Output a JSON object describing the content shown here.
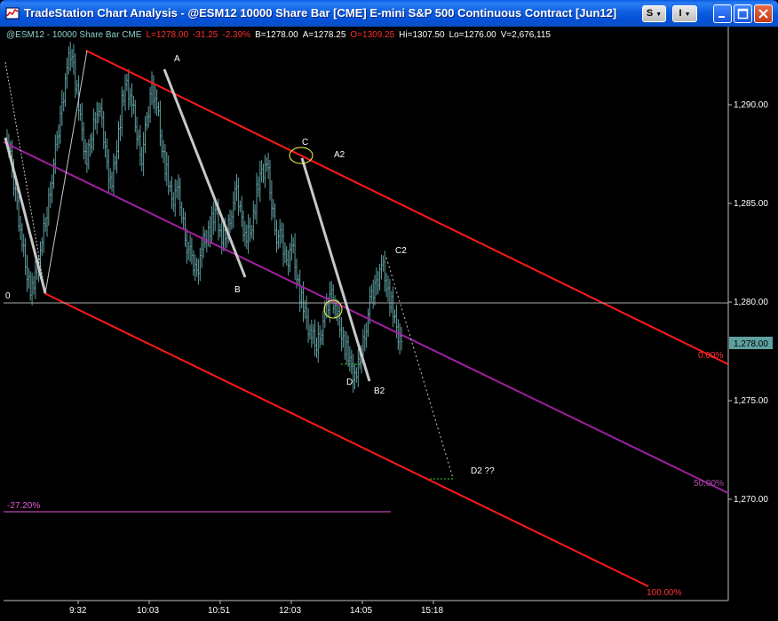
{
  "window": {
    "title": "TradeStation Chart Analysis - @ESM12 10000 Share Bar [CME] E-mini S&P 500 Continuous Contract [Jun12]",
    "symbol_button": "S",
    "indicator_button": "I"
  },
  "info_bar": {
    "symbol": "@ESM12 - 10000 Share Bar  CME",
    "last": "L=1278.00",
    "net_change": "-31.25",
    "pct_change": "-2.39%",
    "bid": "B=1278.00",
    "ask": "A=1278.25",
    "open": "O=1309.25",
    "high": "Hi=1307.50",
    "low": "Lo=1276.00",
    "volume": "V=2,676,115"
  },
  "price_axis": {
    "labels": [
      "1,290.00",
      "1,285.00",
      "1,280.00",
      "1,275.00",
      "1,270.00"
    ],
    "last_price_tag": "1,278.00"
  },
  "time_axis": {
    "labels": [
      "9:32",
      "10:03",
      "10:51",
      "12:03",
      "14:05",
      "15:18"
    ]
  },
  "annotations": {
    "wave_labels": [
      "A",
      "B",
      "C",
      "A2",
      "C2",
      "D",
      "B2",
      "D2  ??"
    ],
    "zero_marker": "0",
    "channel_levels": [
      "0.00%",
      "50.00%",
      "100.00%"
    ],
    "fib_extension": "-27.20%"
  },
  "colors": {
    "price_bars": "#5f9ea0",
    "channel": "#ff1a1a",
    "median": "#a020a0",
    "fib_extension": "#e65ad6",
    "swing_lines": "#c8c8c8",
    "last_tag_bg": "#5fa0a0"
  },
  "chart_data": {
    "type": "ohlc-bar",
    "symbol": "@ESM12",
    "bar_interval": "10000 Share Bar",
    "price_ticks": [
      1290,
      1285,
      1280,
      1275,
      1270
    ],
    "time_ticks": [
      "9:32",
      "10:03",
      "10:51",
      "12:03",
      "14:05",
      "15:18"
    ],
    "last_price": 1278.0,
    "horizontal_line": 1280.0,
    "close_path": [
      1288.5,
      1286.5,
      1285.0,
      1283.0,
      1281.5,
      1280.5,
      1281.5,
      1283.0,
      1284.5,
      1286.5,
      1288.0,
      1290.0,
      1292.0,
      1292.8,
      1290.5,
      1288.5,
      1287.0,
      1288.5,
      1290.0,
      1289.0,
      1287.0,
      1286.0,
      1288.0,
      1290.0,
      1291.0,
      1290.0,
      1288.5,
      1287.5,
      1289.0,
      1291.0,
      1290.0,
      1288.0,
      1286.5,
      1285.0,
      1285.8,
      1284.5,
      1283.0,
      1282.0,
      1281.5,
      1282.8,
      1283.5,
      1284.0,
      1284.5,
      1283.0,
      1283.5,
      1284.8,
      1285.5,
      1284.2,
      1283.2,
      1284.0,
      1285.5,
      1286.5,
      1287.0,
      1285.0,
      1283.5,
      1283.0,
      1282.0,
      1283.0,
      1281.5,
      1280.0,
      1279.0,
      1278.2,
      1277.8,
      1278.8,
      1279.5,
      1280.5,
      1279.5,
      1278.5,
      1277.5,
      1276.5,
      1276.2,
      1277.5,
      1279.0,
      1280.2,
      1281.0,
      1282.0,
      1281.0,
      1279.8,
      1278.5,
      1278.0
    ],
    "swings": [
      {
        "from": 1289.5,
        "to": 1280.5
      },
      {
        "from": 1292.8,
        "to": 1280.5
      },
      {
        "label": "A",
        "from": 1291.8,
        "to": 1281.3
      },
      {
        "label": "C",
        "from": 1287.2,
        "to": 1276.0
      },
      {
        "label": "C2",
        "from": 1282.0,
        "to": 1271.2
      }
    ],
    "channel_levels": [
      "0.00%",
      "50.00%",
      "100.00%"
    ],
    "fib_extension": "-27.20%"
  }
}
